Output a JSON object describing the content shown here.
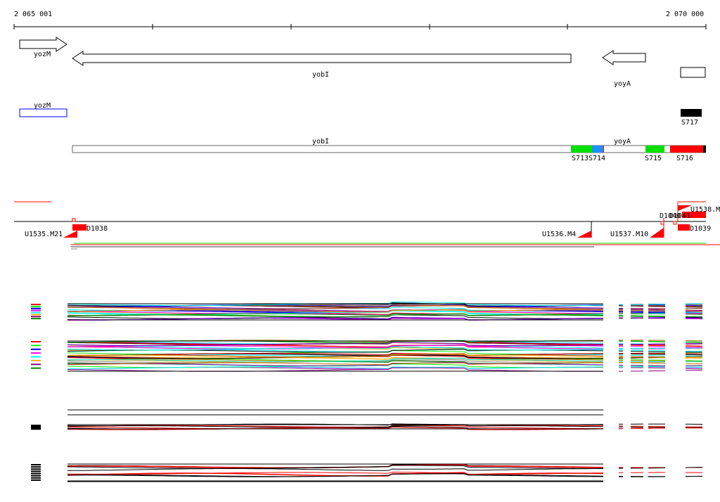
{
  "ruler": {
    "start_label": "2 065 001",
    "end_label": "2 070 000"
  },
  "genes": {
    "yozM": "yozM",
    "yobI": "yobI",
    "yoyA": "yoyA"
  },
  "cds_track": {
    "yozM": "yozM",
    "yobI": "yobI",
    "yoyA": "yoyA"
  },
  "segments": {
    "s713": "S713",
    "s714": "S714",
    "s715": "S715",
    "s716": "S716",
    "s717": "S717"
  },
  "features": {
    "u1535": "U1535.M21",
    "u1536": "U1536.M4",
    "u1537": "U1537.M10",
    "u1538": "U1538.M",
    "d1038": "D1038",
    "d1039": "D1039",
    "d1040": "D1040",
    "d1041": "D1041"
  },
  "colors": {
    "green": "#00e000",
    "blue": "#1e90ff",
    "red": "#ff0000",
    "black": "#000000",
    "cds_outline": "#0000ff"
  }
}
